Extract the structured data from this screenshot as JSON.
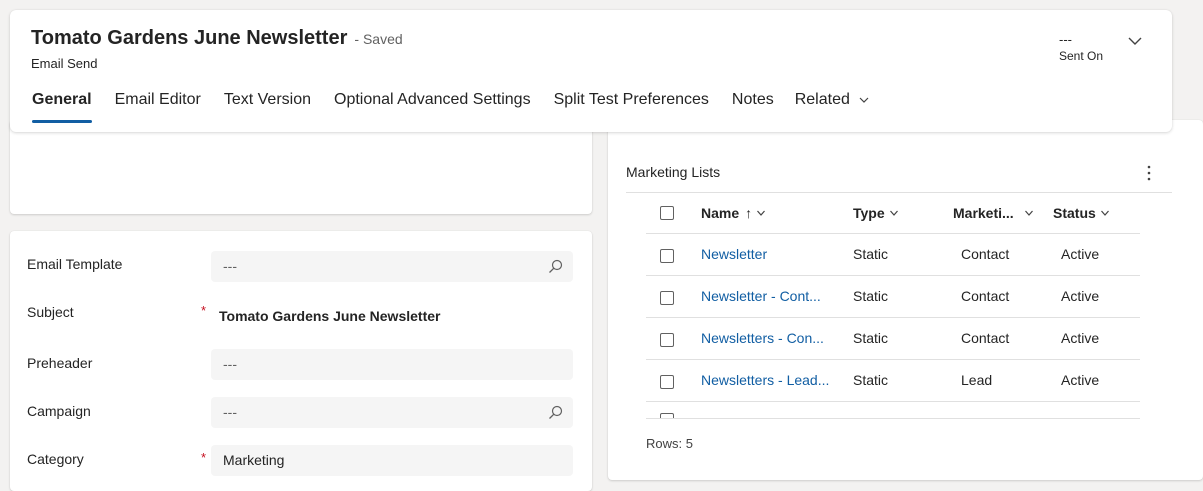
{
  "header": {
    "title": "Tomato Gardens June Newsletter",
    "saved_status": "- Saved",
    "entity": "Email Send",
    "sent_on_value": "---",
    "sent_on_label": "Sent On"
  },
  "tabs": [
    {
      "label": "General",
      "active": true
    },
    {
      "label": "Email Editor"
    },
    {
      "label": "Text Version"
    },
    {
      "label": "Optional Advanced Settings"
    },
    {
      "label": "Split Test Preferences"
    },
    {
      "label": "Notes"
    },
    {
      "label": "Related"
    }
  ],
  "form": {
    "email_template": {
      "label": "Email Template",
      "value": "---"
    },
    "subject": {
      "label": "Subject",
      "required": "*",
      "value": "Tomato Gardens June Newsletter"
    },
    "preheader": {
      "label": "Preheader",
      "value": "---"
    },
    "campaign": {
      "label": "Campaign",
      "value": "---"
    },
    "category": {
      "label": "Category",
      "required": "*",
      "value": "Marketing"
    }
  },
  "marketing_lists": {
    "title": "Marketing Lists",
    "columns": {
      "name": "Name",
      "sort": "↑",
      "type": "Type",
      "marketing": "Marketi...",
      "status": "Status"
    },
    "rows": [
      {
        "name": "Newsletter",
        "type": "Static",
        "marketing": "Contact",
        "status": "Active"
      },
      {
        "name": "Newsletter - Cont...",
        "type": "Static",
        "marketing": "Contact",
        "status": "Active"
      },
      {
        "name": "Newsletters - Con...",
        "type": "Static",
        "marketing": "Contact",
        "status": "Active"
      },
      {
        "name": "Newsletters - Lead...",
        "type": "Static",
        "marketing": "Lead",
        "status": "Active"
      }
    ],
    "rows_count": "Rows: 5"
  },
  "colors": {
    "accent": "#115ea3",
    "required": "#c50f1f"
  }
}
